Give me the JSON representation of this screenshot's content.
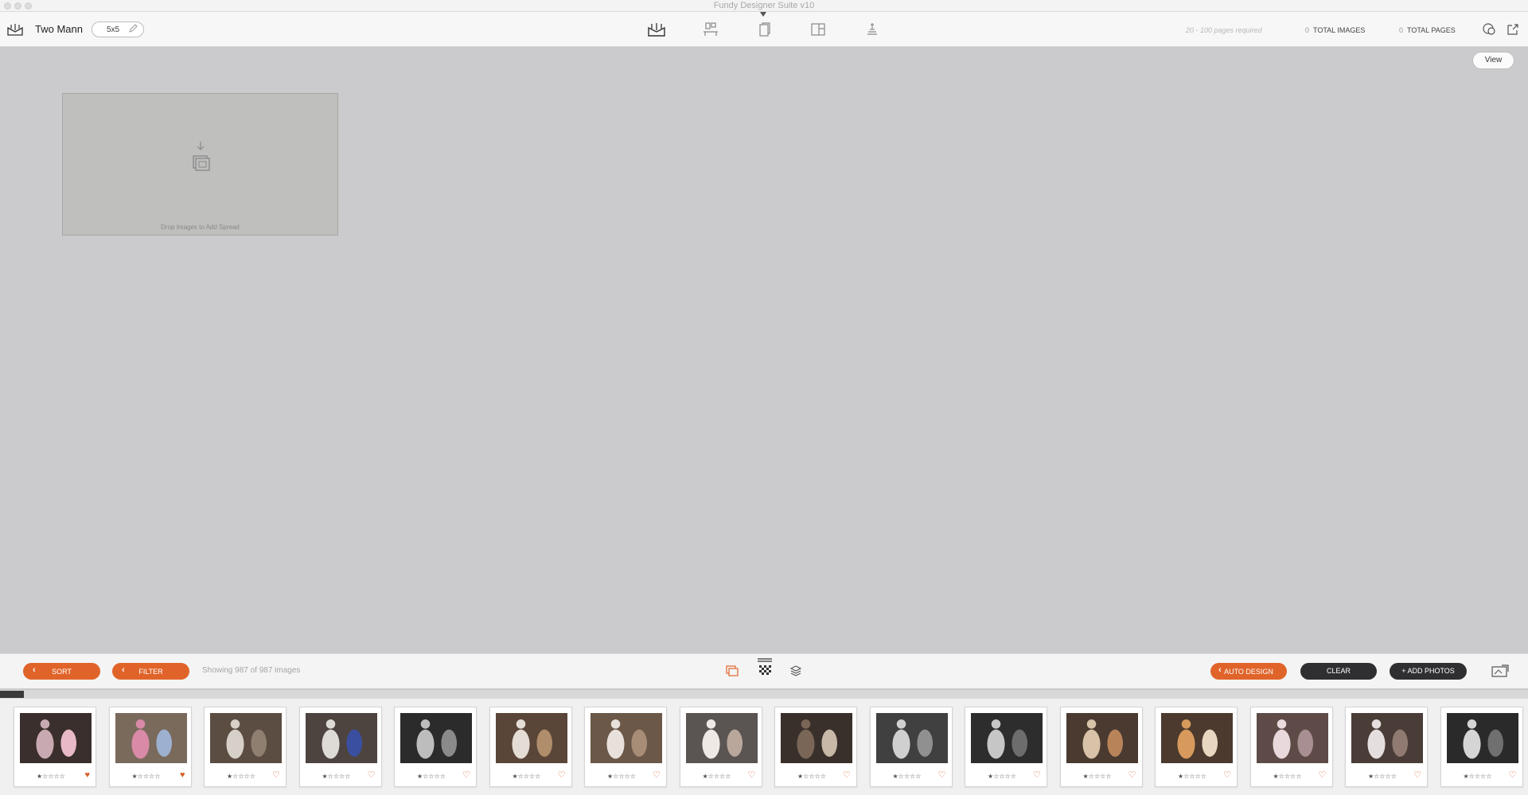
{
  "window": {
    "title": "Fundy Designer Suite v10"
  },
  "toolbar": {
    "project_name": "Two Mann",
    "album_size": "5x5",
    "mode_icons": [
      "album-designer-icon",
      "wall-art-icon",
      "cards-icon",
      "image-box-icon",
      "sales-icon"
    ],
    "pages_required": "20 - 100 pages required",
    "total_images_count": "0",
    "total_images_label": "TOTAL IMAGES",
    "total_pages_count": "0",
    "total_pages_label": "TOTAL PAGES"
  },
  "canvas": {
    "view_label": "View",
    "drop_text": "Drop Images to Add Spread"
  },
  "bottombar": {
    "sort_label": "SORT",
    "filter_label": "FILTER",
    "showing_text": "Showing 987 of 987 images",
    "auto_design_label": "AUTO DESIGN",
    "clear_label": "CLEAR",
    "add_photos_label": "+ ADD PHOTOS"
  },
  "colors": {
    "accent": "#e0642a",
    "dark_button": "#2f2f31",
    "canvas_bg": "#cbcbcd"
  },
  "filmstrip": {
    "images": [
      {
        "stars": "★☆☆☆☆",
        "favorite": true
      },
      {
        "stars": "★☆☆☆☆",
        "favorite": true
      },
      {
        "stars": "★☆☆☆☆",
        "favorite": false
      },
      {
        "stars": "★☆☆☆☆",
        "favorite": false
      },
      {
        "stars": "★☆☆☆☆",
        "favorite": false
      },
      {
        "stars": "★☆☆☆☆",
        "favorite": false
      },
      {
        "stars": "★☆☆☆☆",
        "favorite": false
      },
      {
        "stars": "★☆☆☆☆",
        "favorite": false
      },
      {
        "stars": "★☆☆☆☆",
        "favorite": false
      },
      {
        "stars": "★☆☆☆☆",
        "favorite": false
      },
      {
        "stars": "★☆☆☆☆",
        "favorite": false
      },
      {
        "stars": "★☆☆☆☆",
        "favorite": false
      },
      {
        "stars": "★☆☆☆☆",
        "favorite": false
      },
      {
        "stars": "★☆☆☆☆",
        "favorite": false
      },
      {
        "stars": "★☆☆☆☆",
        "favorite": false
      },
      {
        "stars": "★☆☆☆☆",
        "favorite": false
      }
    ]
  }
}
